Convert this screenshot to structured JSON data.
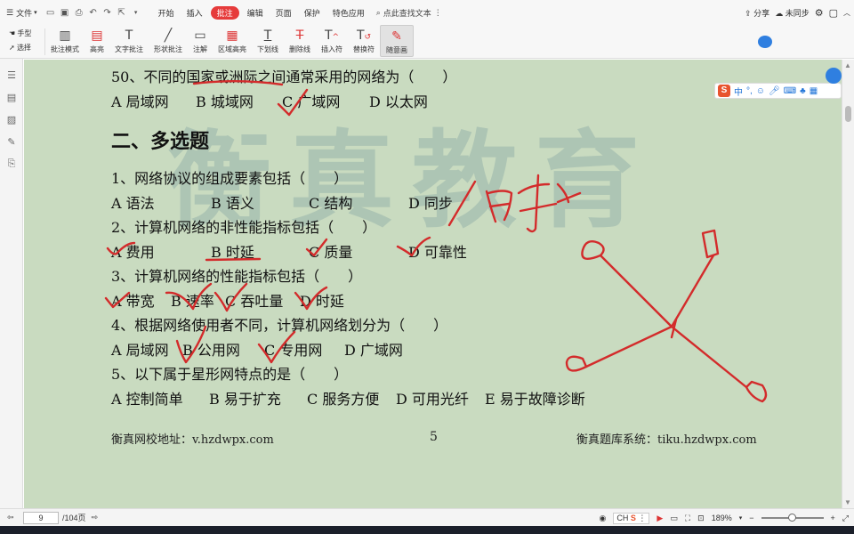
{
  "menubar": {
    "file_label": "文件",
    "tabs": [
      "开始",
      "插入",
      "批注",
      "编辑",
      "页面",
      "保护",
      "特色应用"
    ],
    "active_tab": "批注",
    "search_label": "点此查找文本",
    "share_label": "分享",
    "sync_label": "未同步"
  },
  "ribbon": {
    "hand_label": "手型",
    "select_label": "选择",
    "tools": [
      {
        "icon": "annotation-mode-icon",
        "label": "批注模式"
      },
      {
        "icon": "highlight-icon",
        "label": "高亮"
      },
      {
        "icon": "text-annotation-icon",
        "label": "文字批注"
      },
      {
        "icon": "shape-annotation-icon",
        "label": "形状批注"
      },
      {
        "icon": "note-icon",
        "label": "注解"
      },
      {
        "icon": "area-highlight-icon",
        "label": "区域高亮"
      },
      {
        "icon": "underline-icon",
        "label": "下划线"
      },
      {
        "icon": "strikethrough-icon",
        "label": "删除线"
      },
      {
        "icon": "insert-symbol-icon",
        "label": "插入符"
      },
      {
        "icon": "replace-symbol-icon",
        "label": "替换符"
      },
      {
        "icon": "freehand-draw-icon",
        "label": "随意画"
      }
    ]
  },
  "document": {
    "q50": "50、不同的国家或洲际之间通常采用的网络为（　　）",
    "q50_options": [
      "A  局域网",
      "B  城域网",
      "C  广域网",
      "D  以太网"
    ],
    "section_title": "二、多选题",
    "questions": [
      {
        "text": "1、网络协议的组成要素包括（　　）",
        "options": [
          "A  语法",
          "B  语义",
          "C  结构",
          "D  同步"
        ]
      },
      {
        "text": "2、计算机网络的非性能指标包括（　　）",
        "options": [
          "A  费用",
          "B  时延",
          "C  质量",
          "D  可靠性"
        ]
      },
      {
        "text": "3、计算机网络的性能指标包括（　　）",
        "options": [
          "A  带宽",
          "B  速率",
          "C  吞吐量",
          "D  时延"
        ]
      },
      {
        "text": "4、根据网络使用者不同，计算机网络划分为（　　）",
        "options": [
          "A 局域网",
          "B  公用网",
          "C 专用网",
          "D  广域网"
        ]
      },
      {
        "text": "5、以下属于星形网特点的是（　　）",
        "options": [
          "A  控制简单",
          "B  易于扩充",
          "C 服务方便",
          "D 可用光纤",
          "E  易于故障诊断"
        ]
      }
    ],
    "footer_left": "衡真网校地址：v.hzdwpx.com",
    "page_number": "5",
    "footer_right": "衡真题库系统：tiku.hzdwpx.com",
    "watermark": "衡真教育",
    "handwriting": "/时序"
  },
  "ime": {
    "logo": "S",
    "mode": "中"
  },
  "statusbar": {
    "current_page": "9",
    "total_pages": "/104页",
    "ime_label": "CH",
    "zoom": "189%"
  },
  "colors": {
    "ink": "#d32b2b",
    "page_bg": "#c9dbc0",
    "active_tab": "#e63b3b"
  }
}
